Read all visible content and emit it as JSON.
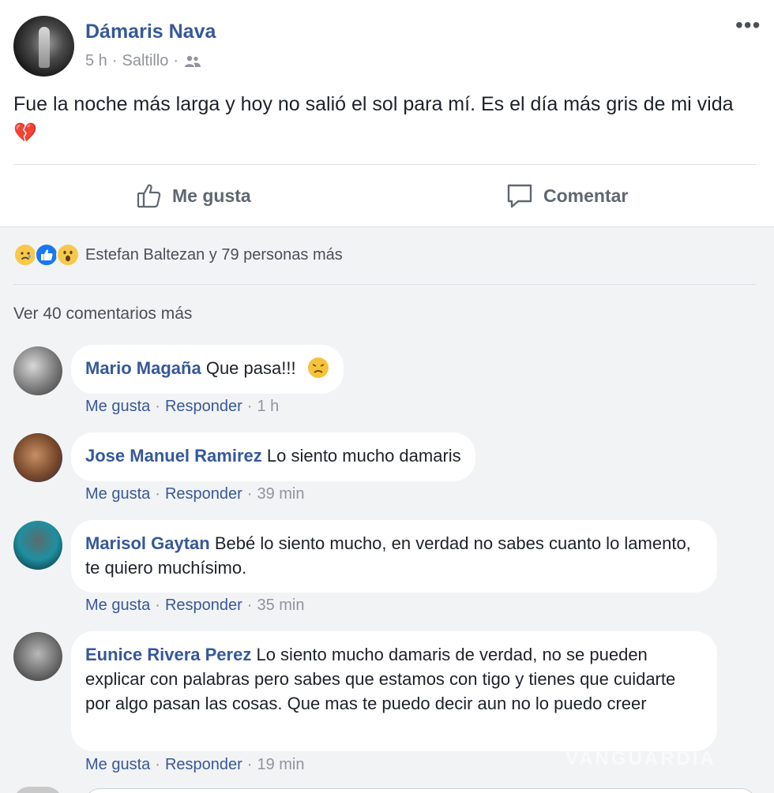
{
  "post": {
    "author": "Dámaris Nava",
    "time": "5 h",
    "location": "Saltillo",
    "text_main": "Fue la noche más larga y hoy no salió el sol para mí. Es el día más gris de mi vida",
    "heart_emoji": "💔",
    "more_label": "•••",
    "actions": {
      "like": "Me gusta",
      "comment": "Comentar"
    }
  },
  "reactions": {
    "summary": "Estefan Baltezan y 79 personas más",
    "icons": [
      "sad-emoji",
      "like-emoji",
      "wow-emoji"
    ]
  },
  "view_more": "Ver 40 comentarios más",
  "comments": [
    {
      "name": "Mario Magaña",
      "text": "Que pasa!!!",
      "like": "Me gusta",
      "reply": "Responder",
      "time": "1 h"
    },
    {
      "name": "Jose Manuel Ramirez",
      "text": "Lo siento mucho damaris",
      "like": "Me gusta",
      "reply": "Responder",
      "time": "39 min"
    },
    {
      "name": "Marisol Gaytan",
      "text": "Bebé lo siento mucho, en verdad no sabes cuanto lo lamento, te quiero muchísimo.",
      "like": "Me gusta",
      "reply": "Responder",
      "time": "35 min"
    },
    {
      "name": "Eunice Rivera Perez",
      "text": "Lo siento mucho damaris de verdad, no se pueden explicar con palabras pero sabes que estamos con tigo y tienes que cuidarte por algo pasan las cosas. Que mas te puedo decir aun no lo puedo creer",
      "like": "Me gusta",
      "reply": "Responder",
      "time": "19 min"
    }
  ],
  "separator": "·",
  "watermark": "VANGUARDIA",
  "colors": {
    "link": "#365899",
    "background": "#f2f3f5",
    "meta": "#90949c"
  }
}
